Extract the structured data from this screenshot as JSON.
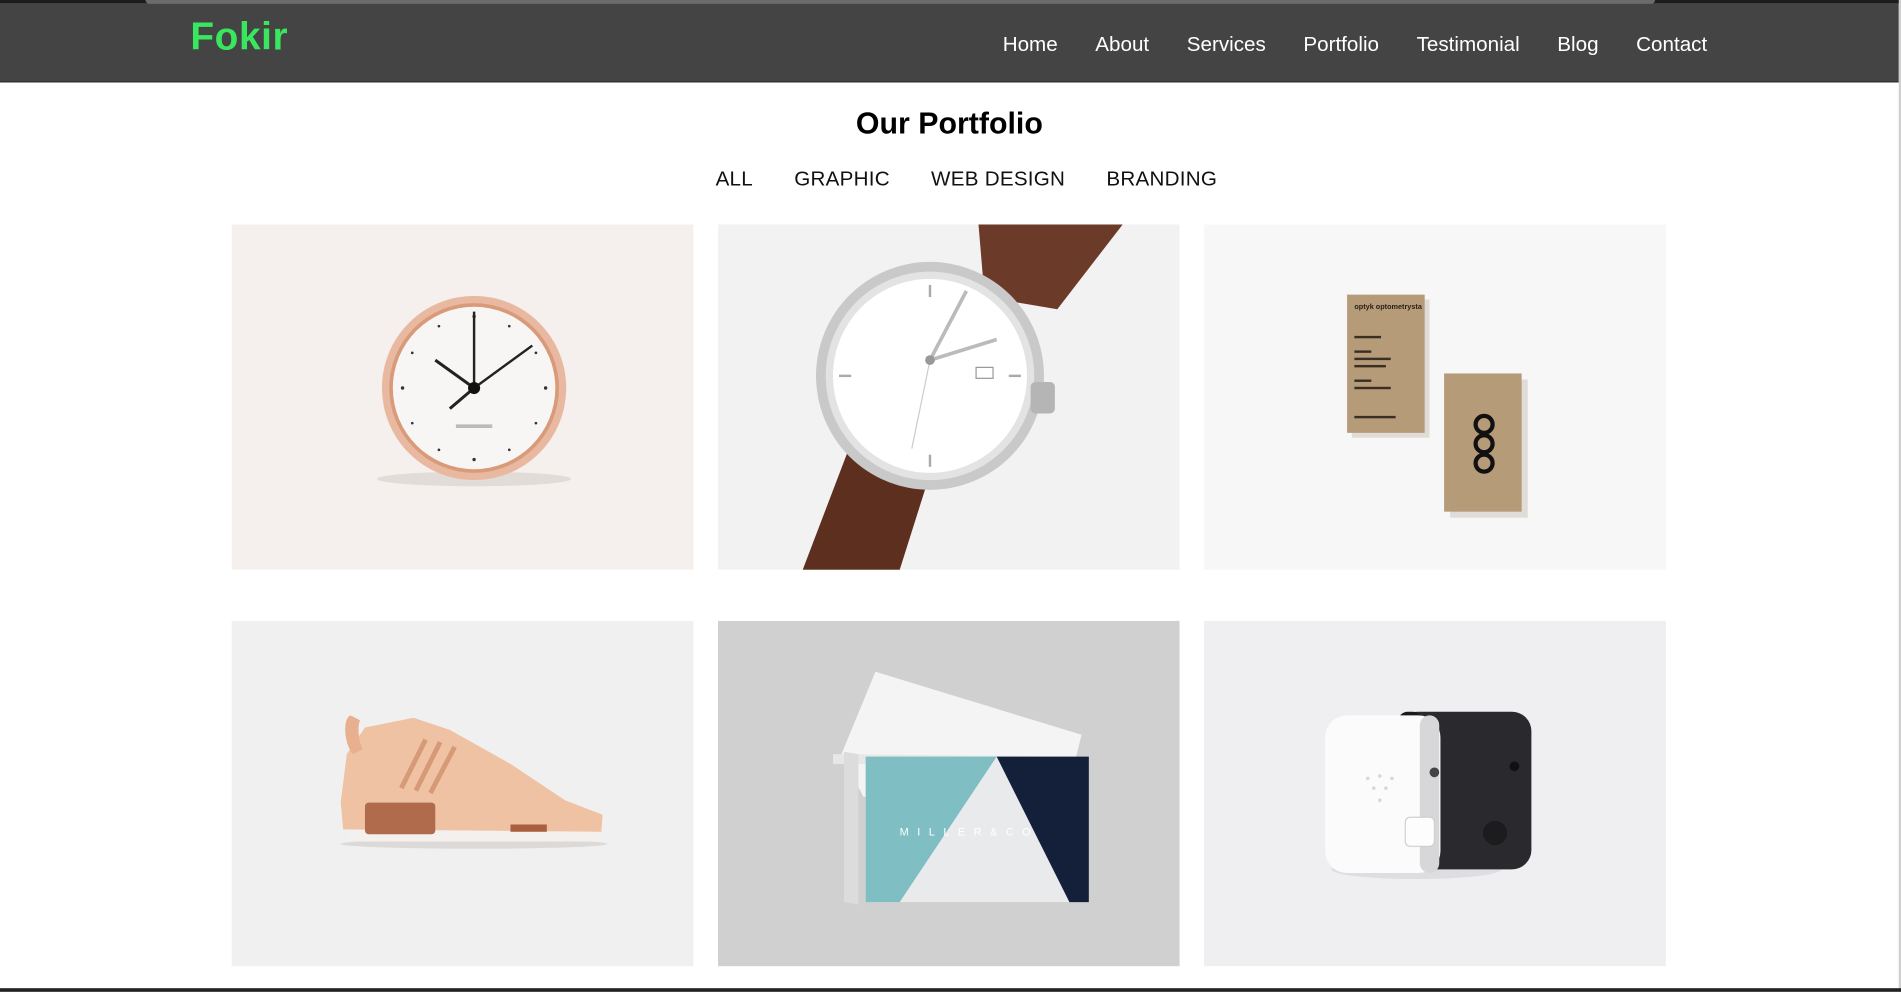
{
  "brand": {
    "name": "Fokir",
    "color": "#39e75f"
  },
  "nav": {
    "items": [
      {
        "label": "Home"
      },
      {
        "label": "About"
      },
      {
        "label": "Services"
      },
      {
        "label": "Portfolio"
      },
      {
        "label": "Testimonial"
      },
      {
        "label": "Blog"
      },
      {
        "label": "Contact"
      }
    ]
  },
  "portfolio": {
    "title": "Our Portfolio",
    "filters": [
      {
        "label": "ALL"
      },
      {
        "label": "GRAPHIC"
      },
      {
        "label": "WEB DESIGN"
      },
      {
        "label": "BRANDING"
      }
    ],
    "items": [
      {
        "image": "wall-clock",
        "bg": "#f5f0ed"
      },
      {
        "image": "wrist-watch",
        "bg": "#f2f2f2"
      },
      {
        "image": "kraft-business-cards",
        "bg": "#f7f7f7",
        "card_text": "optyk optometrysta",
        "logo_text": "OOO"
      },
      {
        "image": "sneaker",
        "bg": "#f1f0f0"
      },
      {
        "image": "miller-co-business-cards",
        "bg": "#d0d0d0",
        "card_text": "MILLER&CO"
      },
      {
        "image": "speaker-devices",
        "bg": "#efeef0"
      }
    ]
  },
  "colors": {
    "navbar_bg": "#444444",
    "nav_text": "#ffffff",
    "accent": "#39e75f"
  }
}
